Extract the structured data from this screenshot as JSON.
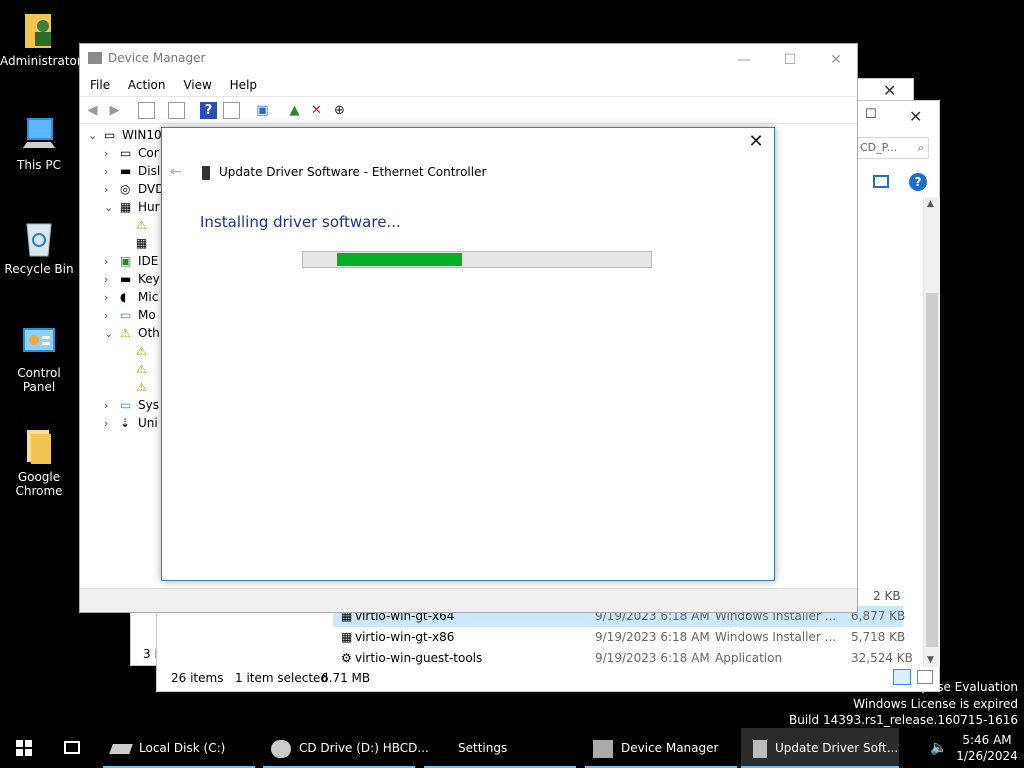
{
  "desktop": {
    "icons": [
      {
        "label": "Administrator",
        "icon": "user-folder-icon"
      },
      {
        "label": "This PC",
        "icon": "computer-icon"
      },
      {
        "label": "Recycle Bin",
        "icon": "recycle-bin-icon"
      },
      {
        "label": "Control Panel",
        "icon": "control-panel-icon"
      },
      {
        "label": "Google Chrome",
        "icon": "folder-icon"
      }
    ]
  },
  "explorer": {
    "search_placeholder": "CD_P...",
    "files": [
      {
        "name": "virtio-win-gt-x64",
        "date": "9/19/2023 6:18 AM",
        "type": "Windows Installer ...",
        "size": "6,877 KB"
      },
      {
        "name": "virtio-win-gt-x86",
        "date": "9/19/2023 6:18 AM",
        "type": "Windows Installer ...",
        "size": "5,718 KB"
      },
      {
        "name": "virtio-win-guest-tools",
        "date": "9/19/2023 6:18 AM",
        "type": "Application",
        "size": "32,524 KB"
      }
    ],
    "above_size": "2 KB",
    "status": {
      "items": "26 items",
      "selected": "1 item selected",
      "selected_size": "6.71 MB"
    },
    "back_status_count": "3 i"
  },
  "device_manager": {
    "title": "Device Manager",
    "menu": {
      "file": "File",
      "action": "Action",
      "view": "View",
      "help": "Help"
    },
    "tree": {
      "root": "WIN10",
      "items": [
        {
          "label": "Cor",
          "expanded": false
        },
        {
          "label": "Disl",
          "expanded": false
        },
        {
          "label": "DVD",
          "expanded": false
        },
        {
          "label": "Hur",
          "expanded": true
        },
        {
          "label": "",
          "child": true
        },
        {
          "label": "",
          "child": true
        },
        {
          "label": "IDE",
          "expanded": false
        },
        {
          "label": "Key",
          "expanded": false
        },
        {
          "label": "Mic",
          "expanded": false
        },
        {
          "label": "Mo",
          "expanded": false
        },
        {
          "label": "Oth",
          "expanded": true
        },
        {
          "label": "",
          "child": true
        },
        {
          "label": "",
          "child": true
        },
        {
          "label": "",
          "child": true
        },
        {
          "label": "Sys",
          "expanded": false
        },
        {
          "label": "Uni",
          "expanded": false
        }
      ]
    }
  },
  "dialog": {
    "title": "Update Driver Software - Ethernet Controller",
    "heading": "Installing driver software...",
    "progress_fraction": 0.36
  },
  "taskbar": {
    "items": [
      {
        "label": "Local Disk (C:)"
      },
      {
        "label": "CD Drive (D:) HBCD..."
      },
      {
        "label": "Settings"
      },
      {
        "label": "Device Manager"
      },
      {
        "label": "Update Driver Soft..."
      }
    ],
    "time": "5:46 AM",
    "date": "1/26/2024"
  },
  "watermark": {
    "line1": "prise Evaluation",
    "line2": "Windows License is expired",
    "line3": "Build 14393.rs1_release.160715-1616"
  },
  "colors": {
    "progress": "#06b025",
    "heading": "#1e3287",
    "accent": "#76b9ed"
  }
}
